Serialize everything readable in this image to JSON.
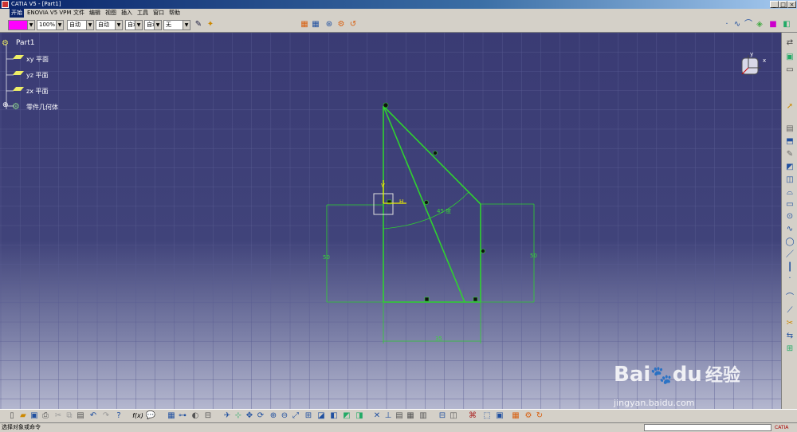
{
  "window": {
    "title": "CATIA V5 - [Part1]",
    "controls": [
      "_",
      "□",
      "×"
    ]
  },
  "menu": {
    "items": [
      "开始",
      "ENOVIA V5 VPM",
      "文件",
      "编辑",
      "视图",
      "插入",
      "工具",
      "窗口",
      "帮助"
    ]
  },
  "toolbar": {
    "color_swatch": "#ff00ff",
    "opacity": "100%",
    "combo2": "自动",
    "combo3": "自动",
    "combo4": "自动",
    "combo5": "自动",
    "combo6": "无"
  },
  "tree": {
    "root": "Part1",
    "items": [
      "xy 平面",
      "yz 平面",
      "zx 平面",
      "零件几何体"
    ]
  },
  "compass": {
    "x_label": "x",
    "y_label": "y"
  },
  "sketch": {
    "color": "#2fd22f",
    "dimensions": {
      "left_height": "50",
      "right_height": "50",
      "angle": "45 度",
      "bottom_width": "35",
      "axis_h": "H",
      "axis_v": "V"
    }
  },
  "watermark": {
    "brand": "Bai",
    "brand2": "du",
    "brand3": "经验",
    "url": "jingyan.baidu.com"
  },
  "status": {
    "prompt": "选择对象或命令"
  },
  "logo": {
    "text": "CATIA"
  }
}
